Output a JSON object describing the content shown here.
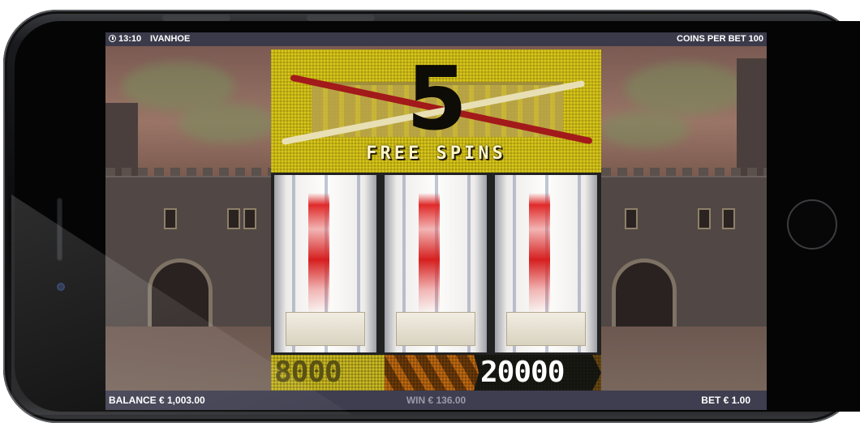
{
  "status_bar": {
    "time": "13:10",
    "game_name": "IVANHOE",
    "coins_per_bet": "COINS PER BET 100"
  },
  "marquee": {
    "free_spins_count": "5",
    "free_spins_label": "FREE SPINS"
  },
  "paytable": {
    "low_prize": "8000",
    "high_prize": "20000"
  },
  "bottom_bar": {
    "balance": "BALANCE € 1,003.00",
    "win": "WIN € 136.00",
    "bet": "BET € 1.00"
  },
  "colors": {
    "bar_bg": "#3b3a4a",
    "marquee_yellow": "#d8c81a",
    "reel_red": "#e02a2a"
  },
  "icons": {
    "clock": "clock-icon"
  }
}
